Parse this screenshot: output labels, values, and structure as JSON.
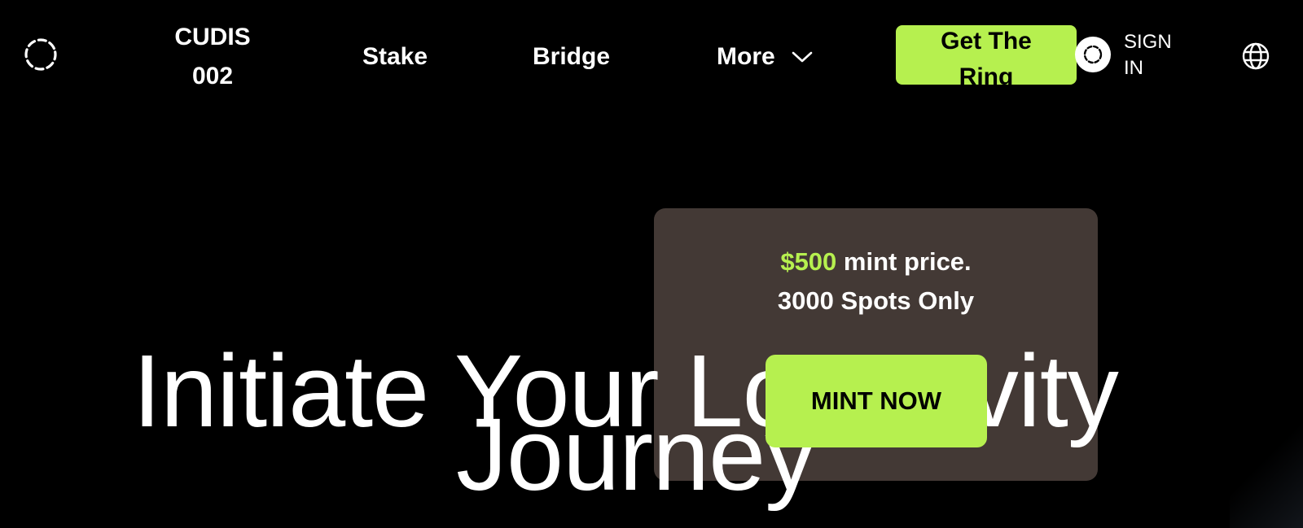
{
  "header": {
    "nav": {
      "cudis_line1": "CUDIS",
      "cudis_line2": "002",
      "stake": "Stake",
      "bridge": "Bridge",
      "more": "More"
    },
    "cta_line1": "Get The",
    "cta_line2": "Ring",
    "signin_line1": "SIGN",
    "signin_line2": "IN",
    "icons": {
      "logo": "cudis-ring-logo-icon",
      "avatar": "user-avatar-icon",
      "more": "chevron-down-icon",
      "language": "globe-icon"
    }
  },
  "hero": {
    "title_line1": "Initiate Your Longevity",
    "title_line2": "Journey",
    "card": {
      "price": "$500",
      "price_suffix": " mint price.",
      "spots": "3000 Spots Only",
      "button": "MINT NOW"
    }
  },
  "colors": {
    "accent": "#b6f04f",
    "background": "#000000",
    "card": "#433935"
  }
}
